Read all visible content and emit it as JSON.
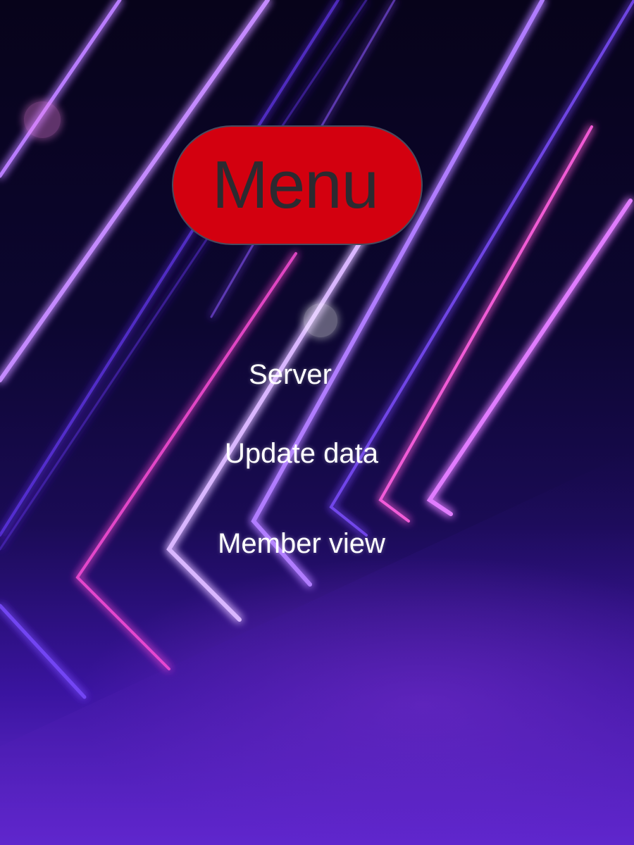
{
  "menu": {
    "title": "Menu",
    "items": [
      {
        "label": "Server"
      },
      {
        "label": "Update data"
      },
      {
        "label": "Member view"
      }
    ]
  },
  "colors": {
    "menu_button_fill": "#d3000f",
    "menu_button_text": "#2c2a30",
    "item_text": "#ffffff",
    "background_dark": "#07041c",
    "neon_pink": "#ff4fd8",
    "neon_violet": "#a05cff"
  }
}
